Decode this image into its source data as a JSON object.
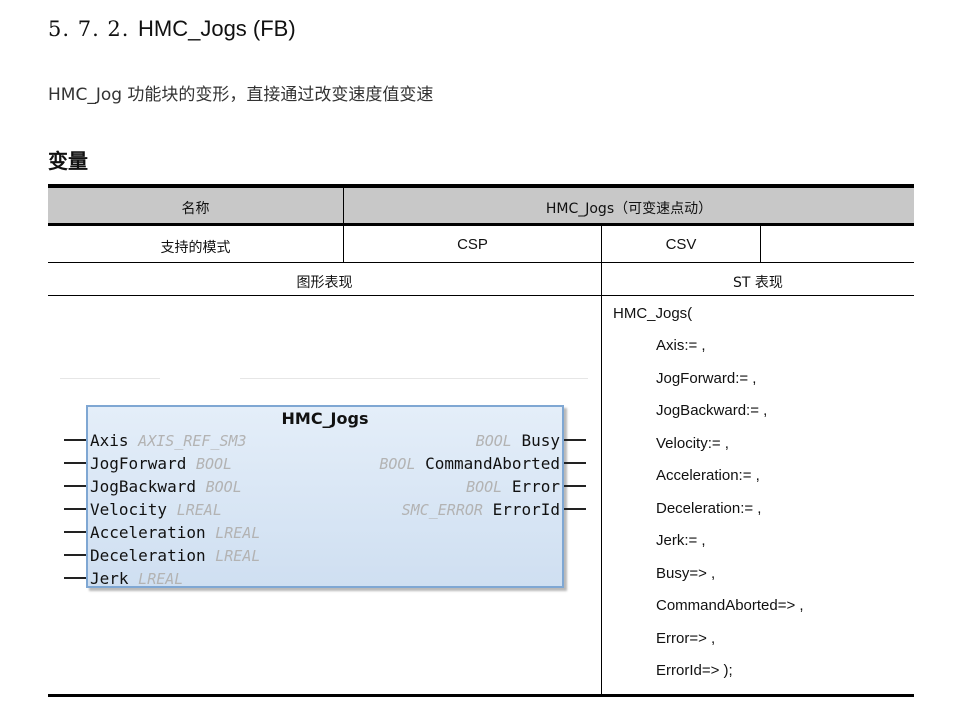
{
  "heading": {
    "number": "5. 7. 2.",
    "title": "HMC_Jogs (FB)"
  },
  "intro": "HMC_Jog 功能块的变形，直接通过改变速度值变速",
  "section_title": "变量",
  "table": {
    "name_label": "名称",
    "name_value": "HMC_Jogs（可变速点动）",
    "modes_label": "支持的模式",
    "mode_csp": "CSP",
    "mode_csv": "CSV",
    "mode_empty": "",
    "graphic_label": "图形表现",
    "st_label": "ST 表现"
  },
  "fb": {
    "title": "HMC_Jogs",
    "inputs": [
      {
        "name": "Axis",
        "type": "AXIS_REF_SM3"
      },
      {
        "name": "JogForward",
        "type": "BOOL"
      },
      {
        "name": "JogBackward",
        "type": "BOOL"
      },
      {
        "name": "Velocity",
        "type": "LREAL"
      },
      {
        "name": "Acceleration",
        "type": "LREAL"
      },
      {
        "name": "Deceleration",
        "type": "LREAL"
      },
      {
        "name": "Jerk",
        "type": "LREAL"
      }
    ],
    "outputs": [
      {
        "name": "Busy",
        "type": "BOOL"
      },
      {
        "name": "CommandAborted",
        "type": "BOOL"
      },
      {
        "name": "Error",
        "type": "BOOL"
      },
      {
        "name": "ErrorId",
        "type": "SMC_ERROR"
      }
    ]
  },
  "st_lines": [
    "HMC_Jogs(",
    "Axis:= ,",
    "JogForward:= ,",
    "JogBackward:= ,",
    "Velocity:= ,",
    "Acceleration:= ,",
    "Deceleration:= ,",
    "Jerk:= ,",
    "Busy=> ,",
    "CommandAborted=> ,",
    "Error=> ,",
    "ErrorId=> );"
  ]
}
